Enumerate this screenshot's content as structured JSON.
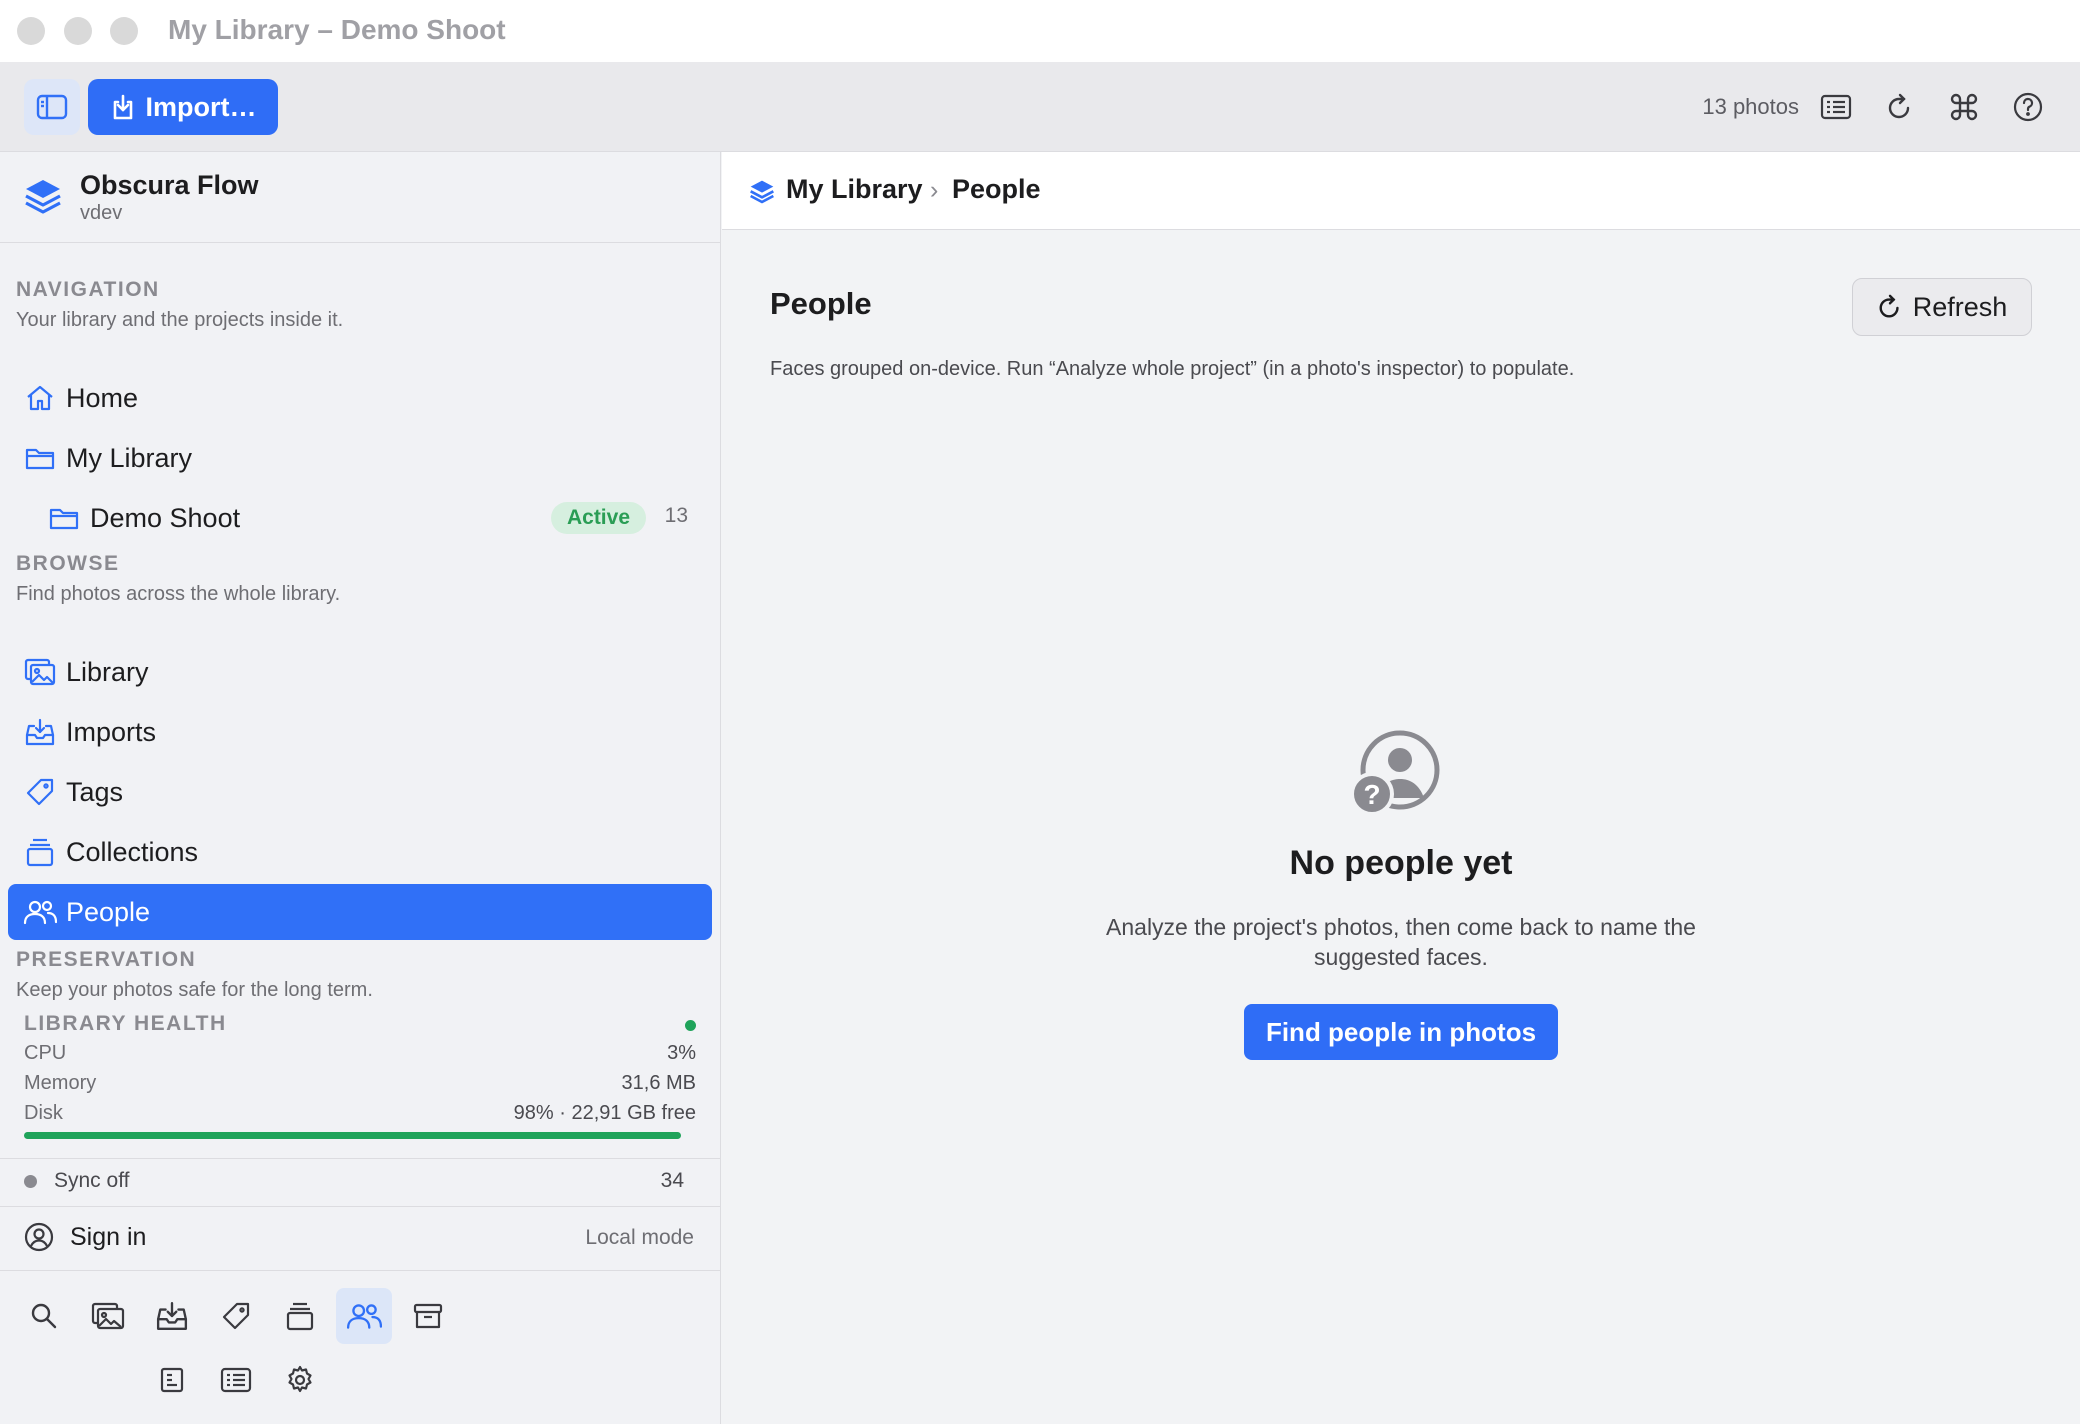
{
  "window": {
    "title": "My Library – Demo Shoot"
  },
  "toolbar": {
    "import_label": "Import…",
    "photo_count": "13 photos"
  },
  "app": {
    "name": "Obscura Flow",
    "version": "vdev"
  },
  "sidebar": {
    "navigation": {
      "title": "NAVIGATION",
      "subtitle": "Your library and the projects inside it.",
      "items": [
        {
          "label": "Home",
          "icon": "house-icon"
        },
        {
          "label": "My Library",
          "icon": "folder-icon"
        },
        {
          "label": "Demo Shoot",
          "icon": "folder-icon",
          "badge": "Active",
          "count": "13"
        }
      ]
    },
    "browse": {
      "title": "BROWSE",
      "subtitle": "Find photos across the whole library.",
      "items": [
        {
          "label": "Library",
          "icon": "photos-icon"
        },
        {
          "label": "Imports",
          "icon": "tray-download-icon"
        },
        {
          "label": "Tags",
          "icon": "tag-icon"
        },
        {
          "label": "Collections",
          "icon": "stack-icon"
        },
        {
          "label": "People",
          "icon": "people-icon",
          "active": true
        }
      ]
    },
    "preservation": {
      "title": "PRESERVATION",
      "subtitle": "Keep your photos safe for the long term."
    },
    "health": {
      "title": "LIBRARY HEALTH",
      "status_color": "#1fa35a",
      "rows": [
        {
          "label": "CPU",
          "value": "3%"
        },
        {
          "label": "Memory",
          "value": "31,6 MB"
        },
        {
          "label": "Disk",
          "value": "98% · 22,91 GB free"
        }
      ],
      "disk_fraction": 0.98
    },
    "sync": {
      "label": "Sync off",
      "count": "34"
    },
    "account": {
      "signin_label": "Sign in",
      "mode": "Local mode"
    }
  },
  "main": {
    "breadcrumb": {
      "library": "My Library",
      "separator": "›",
      "current": "People"
    },
    "title": "People",
    "refresh_label": "Refresh",
    "description": "Faces grouped on-device. Run “Analyze whole project” (in a photo's inspector) to populate.",
    "empty": {
      "title": "No people yet",
      "description": "Analyze the project's photos, then come back to name the suggested faces.",
      "cta": "Find people in photos"
    }
  },
  "colors": {
    "accent": "#2f6df6",
    "success": "#1fa35a",
    "badge_bg": "#d6efdf"
  }
}
